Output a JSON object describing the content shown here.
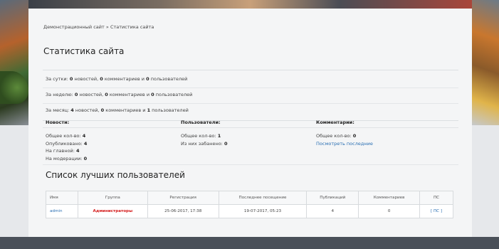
{
  "breadcrumb": {
    "site": "Демонстрационный сайт",
    "sep": "»",
    "current": "Статистика сайта"
  },
  "page_title": "Статистика сайта",
  "periods": [
    {
      "label": "За сутки:",
      "news": "0",
      "news_word": "новостей,",
      "comments": "0",
      "comments_word": "комментариев и",
      "users": "0",
      "users_word": "пользователей"
    },
    {
      "label": "За неделю:",
      "news": "0",
      "news_word": "новостей,",
      "comments": "0",
      "comments_word": "комментариев и",
      "users": "0",
      "users_word": "пользователей"
    },
    {
      "label": "За месяц:",
      "news": "4",
      "news_word": "новостей,",
      "comments": "0",
      "comments_word": "комментариев и",
      "users": "1",
      "users_word": "пользователей"
    }
  ],
  "news_col": {
    "heading": "Новости:",
    "total_label": "Общее кол-во:",
    "total": "4",
    "published_label": "Опубликовано:",
    "published": "4",
    "main_label": "На главной:",
    "main": "4",
    "moderation_label": "На модерации:",
    "moderation": "0"
  },
  "users_col": {
    "heading": "Пользователи:",
    "total_label": "Общее кол-во:",
    "total": "1",
    "banned_label": "Из них забанено:",
    "banned": "0"
  },
  "comments_col": {
    "heading": "Комментарии:",
    "total_label": "Общее кол-во:",
    "total": "0",
    "latest_link": "Посмотреть последние"
  },
  "top_users": {
    "title": "Список лучших пользователей",
    "columns": [
      "Имя",
      "Группа",
      "Регистрация",
      "Последнее посещение",
      "Публикаций",
      "Комментариев",
      "ПС"
    ],
    "rows": [
      {
        "name": "admin",
        "group": "Администраторы",
        "registered": "25-06-2017, 17:38",
        "last_visit": "19-07-2017, 05:23",
        "posts": "4",
        "comments": "0",
        "pm": "[ ПС ]"
      }
    ]
  }
}
